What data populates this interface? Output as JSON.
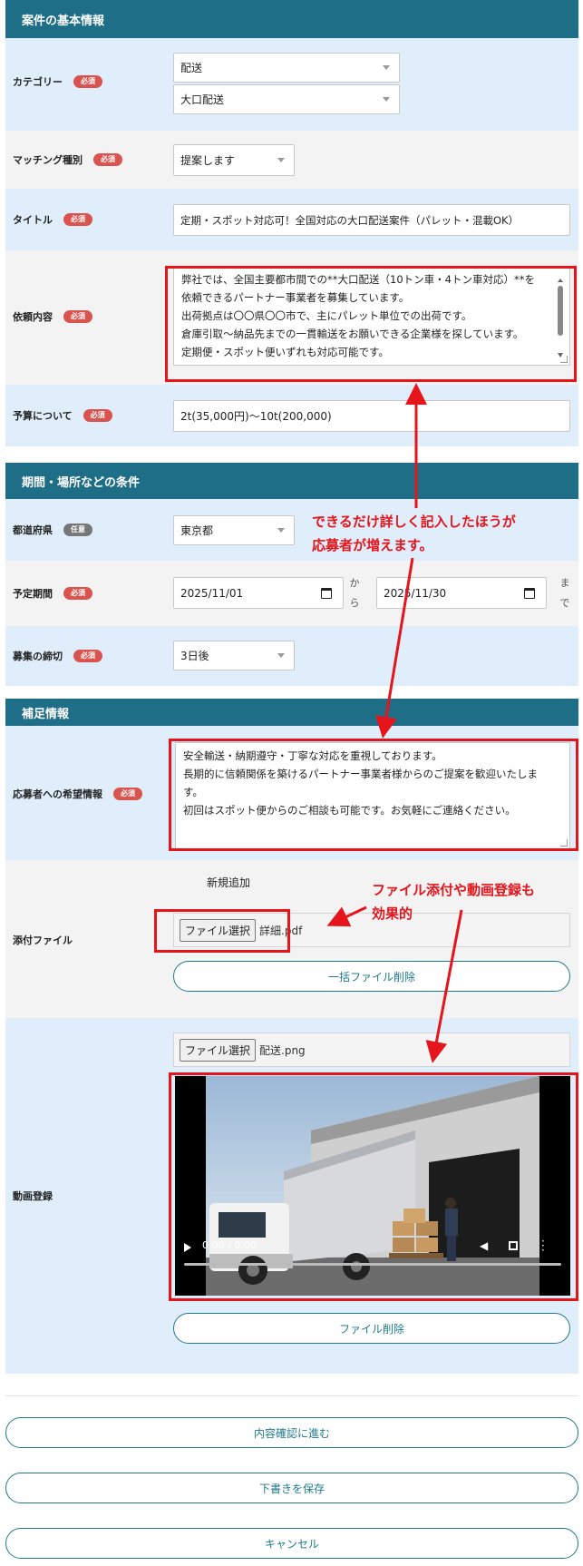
{
  "badges": {
    "required": "必須",
    "optional": "任意"
  },
  "section1": {
    "title": "案件の基本情報",
    "category": {
      "label": "カテゴリー",
      "value1": "配送",
      "value2": "大口配送"
    },
    "matching": {
      "label": "マッチング種別",
      "value": "提案します"
    },
    "title_field": {
      "label": "タイトル",
      "value": "定期・スポット対応可！全国対応の大口配送案件（パレット・混載OK）"
    },
    "request": {
      "label": "依頼内容",
      "lines": [
        "弊社では、全国主要都市間での**大口配送（10トン車・4トン車対応）**を",
        "依頼できるパートナー事業者を募集しています。",
        "出荷拠点は〇〇県〇〇市で、主にパレット単位での出荷です。",
        "倉庫引取～納品先までの一貫輸送をお願いできる企業様を探しています。",
        "定期便・スポット便いずれも対応可能です。"
      ]
    },
    "budget": {
      "label": "予算について",
      "value": "2t(35,000円)～10t(200,000)"
    }
  },
  "section2": {
    "title": "期間・場所などの条件",
    "prefecture": {
      "label": "都道府県",
      "value": "東京都"
    },
    "period": {
      "label": "予定期間",
      "start": "2025/11/01",
      "from_text": "から",
      "end": "2025/11/30",
      "until_text": "まで"
    },
    "deadline": {
      "label": "募集の締切",
      "value": "3日後"
    }
  },
  "section3": {
    "title": "補足情報",
    "wish": {
      "label": "応募者への希望情報",
      "lines": [
        "安全輸送・納期遵守・丁寧な対応を重視しております。",
        "長期的に信頼関係を築けるパートナー事業者様からのご提案を歓迎いたしま",
        "す。",
        "初回はスポット便からのご相談も可能です。お気軽にご連絡ください。"
      ]
    },
    "attachment": {
      "label": "添付ファイル",
      "new_add": "新規追加",
      "file_button": "ファイル選択",
      "file_name": "詳細.pdf",
      "bulk_delete": "一括ファイル削除"
    },
    "video": {
      "label": "動画登録",
      "file_button": "ファイル選択",
      "file_name": "配送.png",
      "time": "0:00 / 0:00",
      "delete": "ファイル削除"
    }
  },
  "annotations": {
    "note1_line1": "できるだけ詳しく記入したほうが",
    "note1_line2": "応募者が増えます。",
    "note2_line1": "ファイル添付や動画登録も",
    "note2_line2": "効果的"
  },
  "actions": {
    "confirm": "内容確認に進む",
    "draft": "下書きを保存",
    "cancel": "キャンセル"
  },
  "colors": {
    "header": "#1f6e88",
    "accent": "#1f7a8c",
    "annotation": "#e6141b",
    "required_badge": "#d9534f"
  }
}
